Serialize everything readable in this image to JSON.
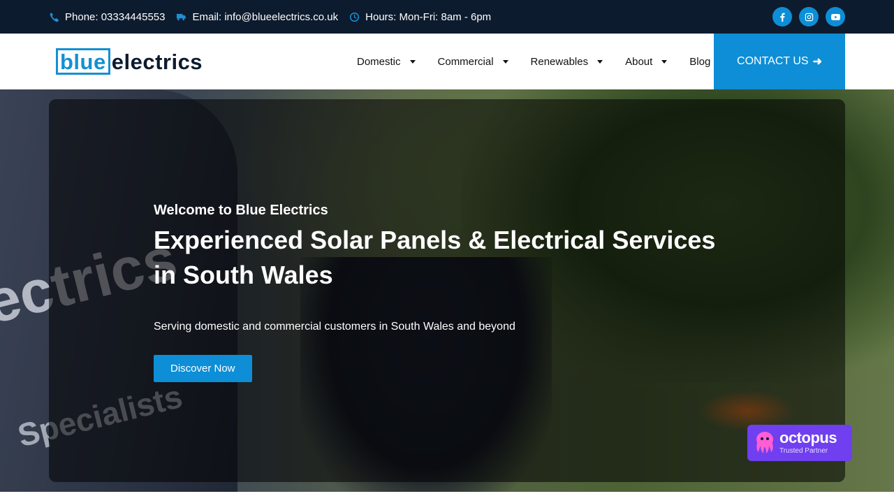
{
  "topbar": {
    "phone": "Phone: 03334445553",
    "email": "Email: info@blueelectrics.co.uk",
    "hours": "Hours: Mon-Fri: 8am - 6pm",
    "phone_icon": "phone-icon",
    "email_icon": "truck-icon",
    "hours_icon": "clock-icon",
    "social": [
      "facebook-icon",
      "instagram-icon",
      "youtube-icon"
    ]
  },
  "logo": {
    "boxed": "blue",
    "rest": "electrics"
  },
  "nav": {
    "items": [
      {
        "label": "Domestic",
        "dropdown": true
      },
      {
        "label": "Commercial",
        "dropdown": true
      },
      {
        "label": "Renewables",
        "dropdown": true
      },
      {
        "label": "About",
        "dropdown": true
      },
      {
        "label": "Blog",
        "dropdown": false
      }
    ],
    "cta": "CONTACT US",
    "cta_icon": "arrow-right-icon"
  },
  "hero": {
    "welcome": "Welcome to Blue Electrics",
    "title_line1": "Experienced Solar Panels & Electrical Services",
    "title_line2": "in South Wales",
    "subtitle": "Serving domestic and commercial customers in South Wales and beyond",
    "button": "Discover Now",
    "van_text": "ectrics",
    "van_text2": "Specialists"
  },
  "badge": {
    "name": "octopus",
    "sub": "Trusted Partner"
  },
  "colors": {
    "topbar_bg": "#0d1b2e",
    "accent": "#0d8ed6",
    "badge_bg": "#6f3ff0"
  }
}
